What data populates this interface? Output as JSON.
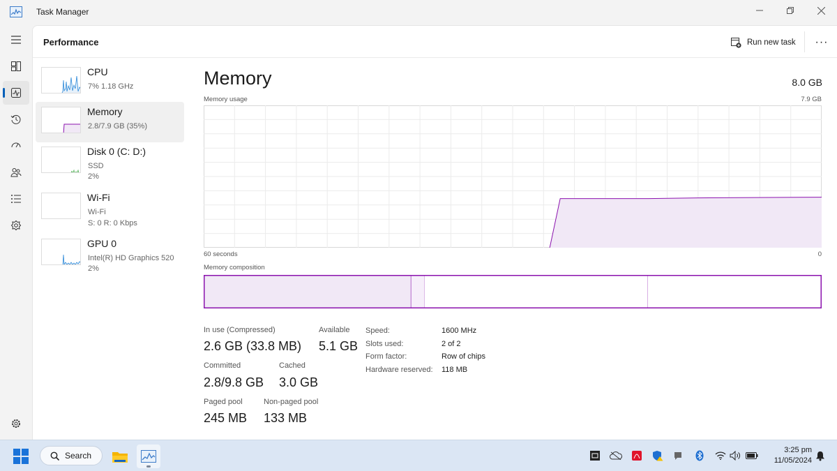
{
  "window": {
    "title": "Task Manager"
  },
  "nav": {
    "items": [
      {
        "icon": "hamburger-icon"
      },
      {
        "icon": "processes-icon"
      },
      {
        "icon": "performance-icon"
      },
      {
        "icon": "app-history-icon"
      },
      {
        "icon": "startup-apps-icon"
      },
      {
        "icon": "users-icon"
      },
      {
        "icon": "details-icon"
      },
      {
        "icon": "services-icon"
      }
    ],
    "settings_icon": "gear-icon"
  },
  "header": {
    "title": "Performance",
    "run_task_label": "Run new task",
    "more_label": "···"
  },
  "resources": [
    {
      "name": "CPU",
      "sub1": "7%  1.18 GHz",
      "sub2": ""
    },
    {
      "name": "Memory",
      "sub1": "2.8/7.9 GB (35%)",
      "sub2": ""
    },
    {
      "name": "Disk 0 (C: D:)",
      "sub1": "SSD",
      "sub2": "2%"
    },
    {
      "name": "Wi-Fi",
      "sub1": "Wi-Fi",
      "sub2": "S: 0  R: 0 Kbps"
    },
    {
      "name": "GPU 0",
      "sub1": "Intel(R) HD Graphics 520",
      "sub2": "2%"
    }
  ],
  "detail": {
    "title": "Memory",
    "total": "8.0 GB",
    "usage_label": "Memory usage",
    "usage_max": "7.9 GB",
    "time_left": "60 seconds",
    "time_right": "0",
    "composition_label": "Memory composition",
    "usage_series": {
      "comment_units": "fraction of max, over last 60 seconds",
      "flat_until_fraction_of_time": 0.56,
      "level": 0.35
    },
    "composition": {
      "in_use_fraction": 0.335,
      "modified_fraction": 0.022,
      "standby_fraction": 0.362,
      "free_fraction": 0.281
    },
    "stats": [
      {
        "label": "In use (Compressed)",
        "value": "2.6 GB (33.8 MB)"
      },
      {
        "label": "Available",
        "value": "5.1 GB"
      },
      {
        "label": "Committed",
        "value": "2.8/9.8 GB"
      },
      {
        "label": "Cached",
        "value": "3.0 GB"
      },
      {
        "label": "Paged pool",
        "value": "245 MB"
      },
      {
        "label": "Non-paged pool",
        "value": "133 MB"
      }
    ],
    "specs": [
      {
        "label": "Speed:",
        "value": "1600 MHz"
      },
      {
        "label": "Slots used:",
        "value": "2 of 2"
      },
      {
        "label": "Form factor:",
        "value": "Row of chips"
      },
      {
        "label": "Hardware reserved:",
        "value": "118 MB"
      }
    ]
  },
  "taskbar": {
    "search_label": "Search",
    "time": "3:25 pm",
    "date": "11/05/2024"
  },
  "colors": {
    "accent": "#005fb8",
    "memory": "#8b12ae",
    "memory_fill": "#f1e8f6",
    "cpu": "#2b88d8",
    "disk": "#4caf50"
  }
}
